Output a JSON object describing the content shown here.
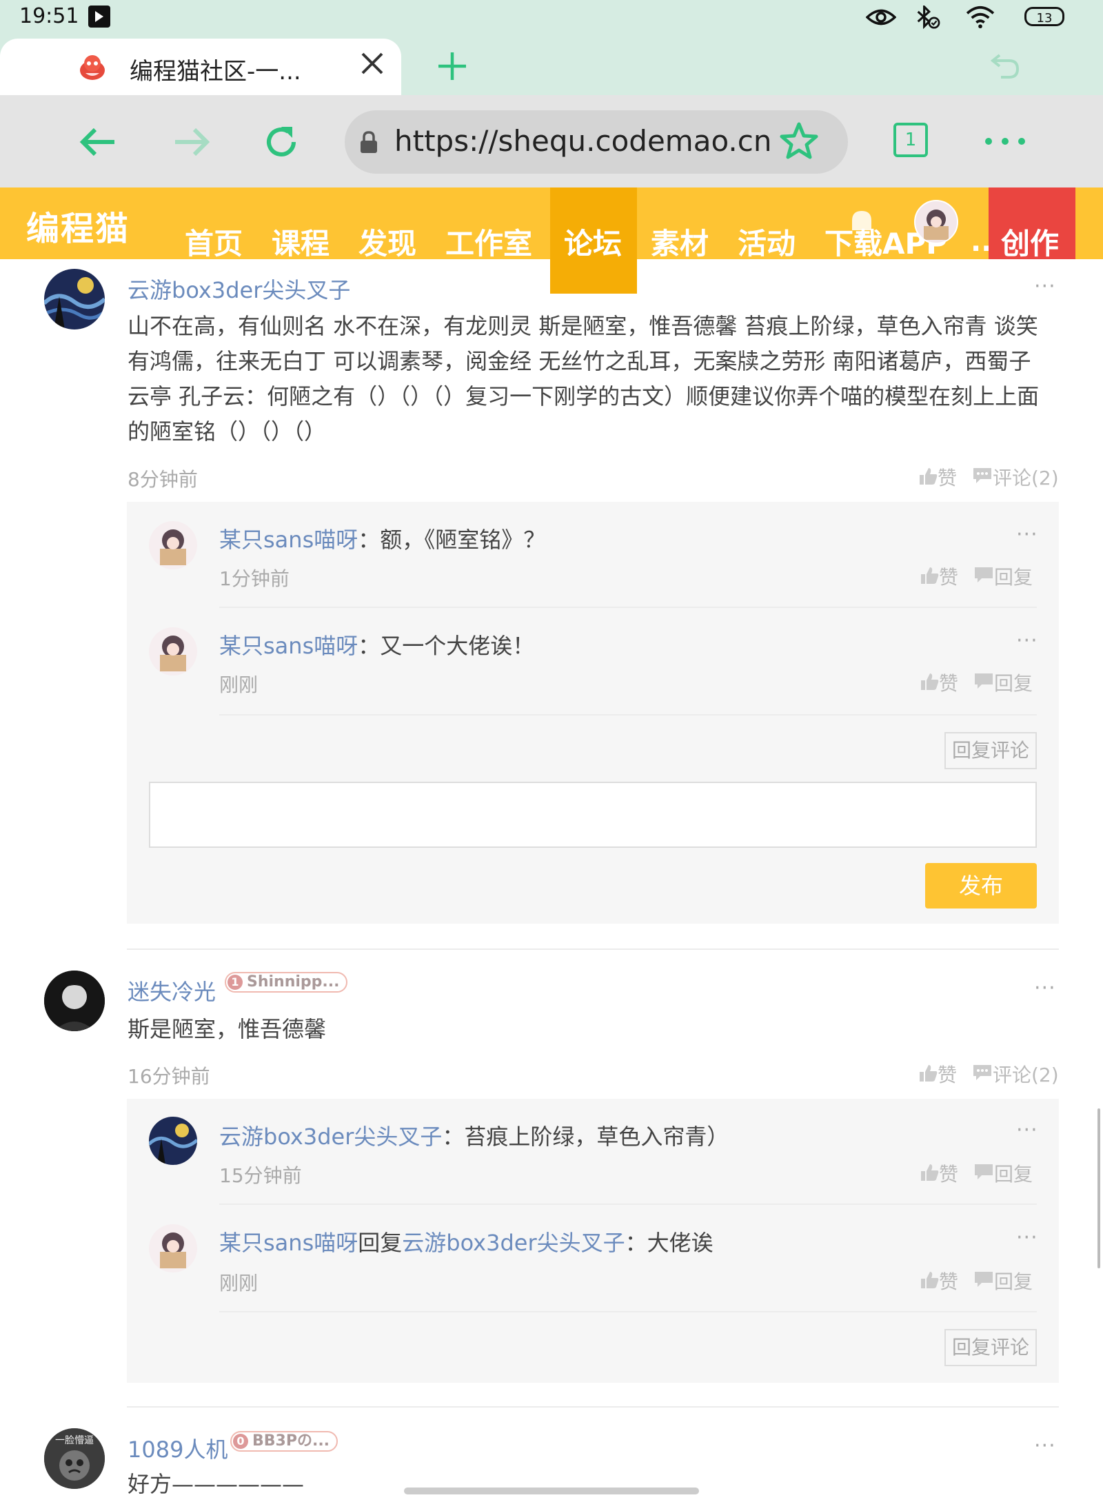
{
  "status": {
    "time": "19:51",
    "battery": "13"
  },
  "tab": {
    "title": "编程猫社区-一..."
  },
  "toolbar": {
    "url": "https://shequ.codemao.cn",
    "tab_count": "1"
  },
  "site": {
    "logo": "编程猫",
    "nav": [
      "首页",
      "课程",
      "发现",
      "工作室",
      "论坛",
      "素材",
      "活动",
      "下载APP"
    ],
    "nav_more": "..",
    "create": "创作"
  },
  "common": {
    "like": "赞",
    "comment": "评论(2)",
    "reply": "回复",
    "reply_comment": "回复评论",
    "publish": "发布",
    "more": "···",
    "colon": "：",
    "reply_to": "回复"
  },
  "posts": [
    {
      "author": "云游box3der尖头叉子",
      "content": "山不在高，有仙则名 水不在深，有龙则灵 斯是陋室，惟吾德馨 苔痕上阶绿，草色入帘青 谈笑有鸿儒，往来无白丁 可以调素琴，阅金经 无丝竹之乱耳，无案牍之劳形 南阳诸葛庐，西蜀子云亭 孔子云：何陋之有（）（）（）复习一下刚学的古文）顺便建议你弄个喵的模型在刻上上面的陋室铭（）（）（）",
      "time": "8分钟前",
      "replies": [
        {
          "author": "某只sans喵呀",
          "text": "额，《陋室铭》？",
          "time": "1分钟前"
        },
        {
          "author": "某只sans喵呀",
          "text": "又一个大佬诶！",
          "time": "刚刚"
        }
      ]
    },
    {
      "author": "迷失冷光",
      "badge_num": "1",
      "badge": "Shinnipp...",
      "content": "斯是陋室，惟吾德馨",
      "time": "16分钟前",
      "replies": [
        {
          "author": "云游box3der尖头叉子",
          "text": "苔痕上阶绿，草色入帘青）",
          "time": "15分钟前"
        },
        {
          "author": "某只sans喵呀",
          "target": "云游box3der尖头叉子",
          "text": "大佬诶",
          "time": "刚刚"
        }
      ]
    },
    {
      "author": "1089人机",
      "avatar_text": "一脸懵逼",
      "badge_num": "0",
      "badge": "BB3Pの...",
      "content": "好方——————"
    }
  ]
}
